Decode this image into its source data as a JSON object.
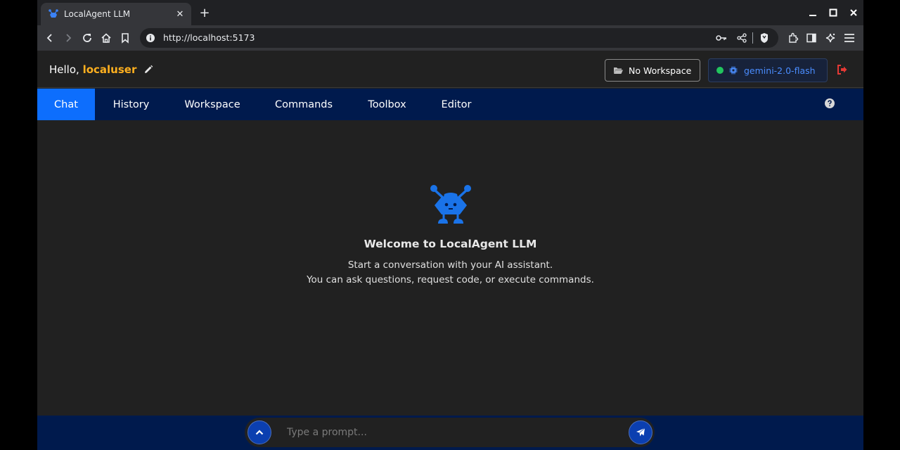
{
  "browser": {
    "tab_title": "LocalAgent LLM",
    "tab_close": "✕",
    "new_tab": "+",
    "url": "http://localhost:5173"
  },
  "header": {
    "greeting": "Hello, ",
    "username": "localuser",
    "workspace_label": "No Workspace",
    "model_label": "gemini-2.0-flash",
    "model_status_color": "#22c55e"
  },
  "nav": {
    "items": [
      {
        "label": "Chat",
        "active": true
      },
      {
        "label": "History"
      },
      {
        "label": "Workspace"
      },
      {
        "label": "Commands"
      },
      {
        "label": "Toolbox"
      },
      {
        "label": "Editor"
      }
    ]
  },
  "welcome": {
    "title": "Welcome to LocalAgent LLM",
    "line1": "Start a conversation with your AI assistant.",
    "line2": "You can ask questions, request code, or execute commands."
  },
  "prompt": {
    "placeholder": "Type a prompt..."
  },
  "colors": {
    "accent": "#0d6efd",
    "nav_bg": "#001a4d",
    "username": "#ffb01f",
    "logout": "#e53935"
  }
}
